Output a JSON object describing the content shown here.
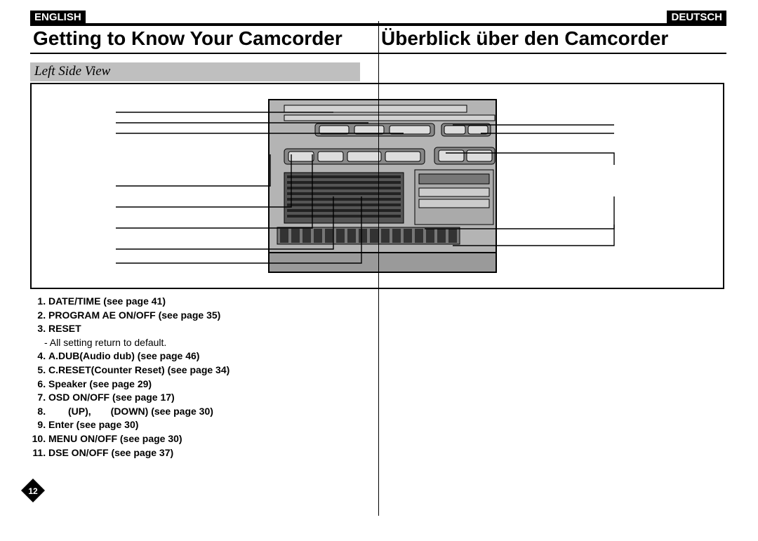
{
  "left": {
    "lang": "ENGLISH",
    "title": "Getting to Know Your Camcorder",
    "subhead": "Left Side View",
    "items": [
      {
        "text": "DATE/TIME (see page 41)"
      },
      {
        "text": "PROGRAM AE ON/OFF (see page 35)"
      },
      {
        "text": "RESET",
        "sub": "- All setting return to default."
      },
      {
        "text": "A.DUB(Audio dub) (see page 46)"
      },
      {
        "text": "C.RESET(Counter Reset) (see page 34)"
      },
      {
        "text": "Speaker (see page 29)"
      },
      {
        "text": "OSD ON/OFF (see page 17)"
      },
      {
        "text": "  (UP),  (DOWN) (see page 30)"
      },
      {
        "text": "Enter (see page 30)"
      },
      {
        "text": "MENU ON/OFF (see page 30)"
      },
      {
        "text": "DSE ON/OFF (see page 37)"
      }
    ]
  },
  "right": {
    "lang": "DEUTSCH",
    "title": "Überblick über den Camcorder"
  },
  "page_number": "12"
}
